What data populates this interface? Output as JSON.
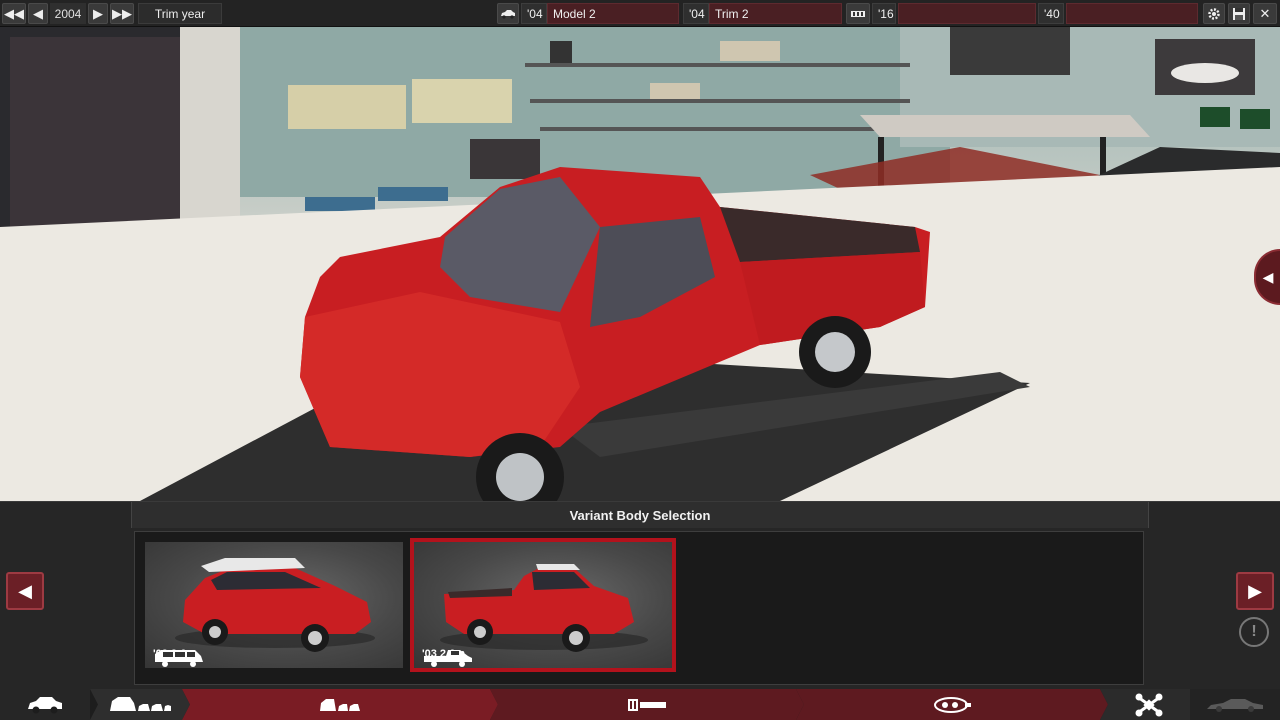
{
  "topbar": {
    "first_label": "◀◀",
    "prev_label": "◀",
    "year": "2004",
    "next_label": "▶",
    "last_label": "▶▶",
    "trim_year_label": "Trim year",
    "model_year": "'04",
    "model_name": "Model 2",
    "trim_year": "'04",
    "trim_name": "Trim 2",
    "engine_year_start": "'16",
    "engine_name": "",
    "engine_year_end": "'40",
    "engine_variant": "",
    "settings_icon": "gear-icon",
    "save_icon": "save-icon",
    "close_label": "✕",
    "accent": "#4a1f23"
  },
  "scene": {
    "side_tab_label": "◀"
  },
  "panel": {
    "title": "Variant Body Selection",
    "prev_label": "◀",
    "next_label": "▶",
    "info_label": "!",
    "cards": [
      {
        "body": "suv",
        "tag": "'03 2.6m",
        "selected": false
      },
      {
        "body": "pickup",
        "tag": "'03 2.6m",
        "selected": true
      }
    ],
    "selection_color": "#b3121c"
  },
  "bottomnav": {
    "items": [
      {
        "icon": "car-icon",
        "active": false
      },
      {
        "icon": "body-variants-icon",
        "active": true
      },
      {
        "icon": "body-variants-icon",
        "active": false
      },
      {
        "icon": "chassis-icon",
        "active": false
      },
      {
        "icon": "engine-icon",
        "active": false
      },
      {
        "icon": "parts-icon",
        "active": false
      },
      {
        "icon": "car-silhouette-icon",
        "active": false
      }
    ],
    "active_color": "#7a1c24"
  }
}
